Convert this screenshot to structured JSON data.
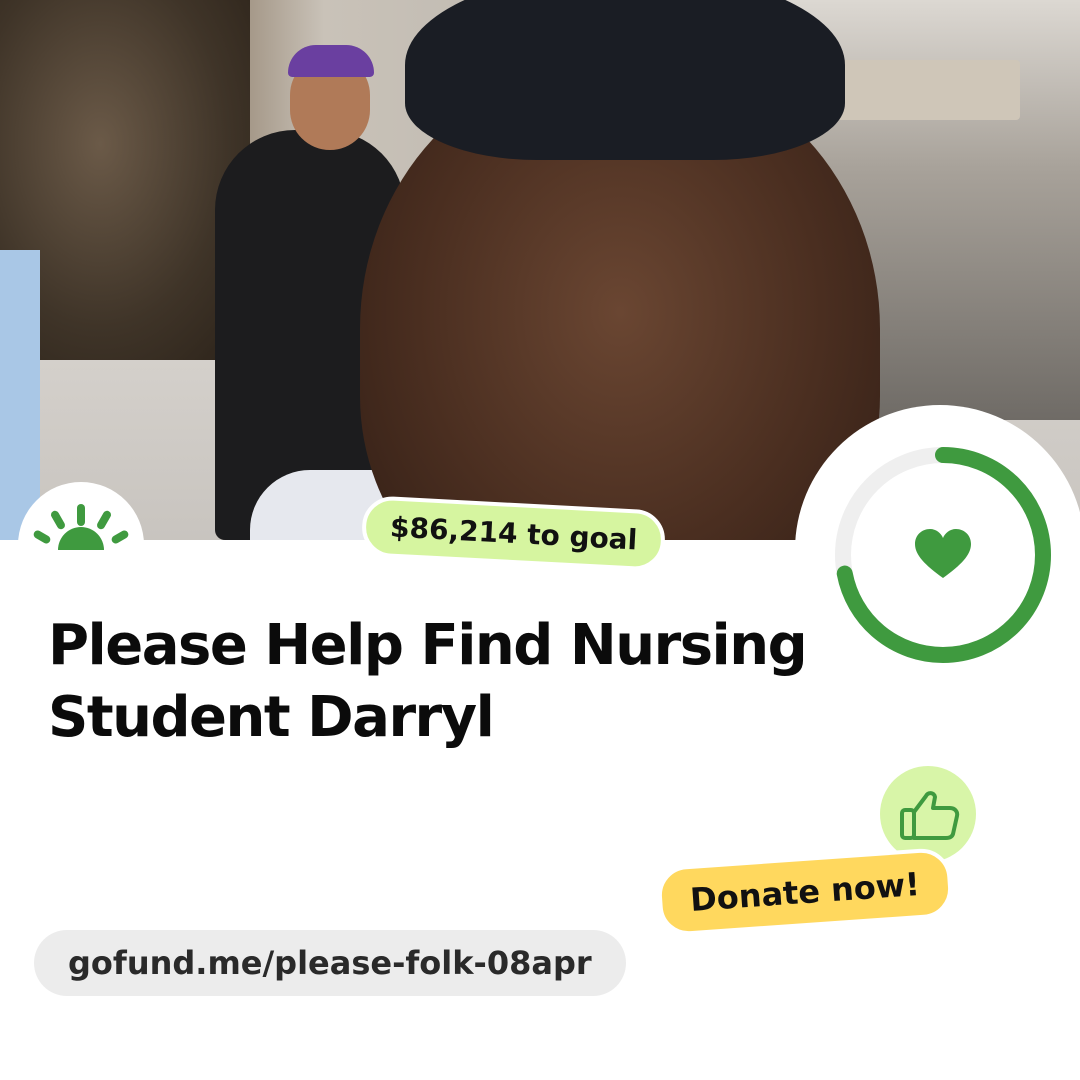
{
  "goal": {
    "text": "$86,214 to goal",
    "progress_fraction": 0.72,
    "accent_color": "#3f9a3f",
    "pill_color": "#d6f5a0"
  },
  "campaign": {
    "title": "Please Help Find Nursing Student Darryl"
  },
  "cta": {
    "donate_label": "Donate now!",
    "color": "#ffd85e"
  },
  "link": {
    "url": "gofund.me/please-folk-08apr"
  },
  "icons": {
    "logo": "gofundme-sunrise-logo",
    "progress_heart": "heart-icon",
    "thumb": "thumbs-up-icon"
  }
}
